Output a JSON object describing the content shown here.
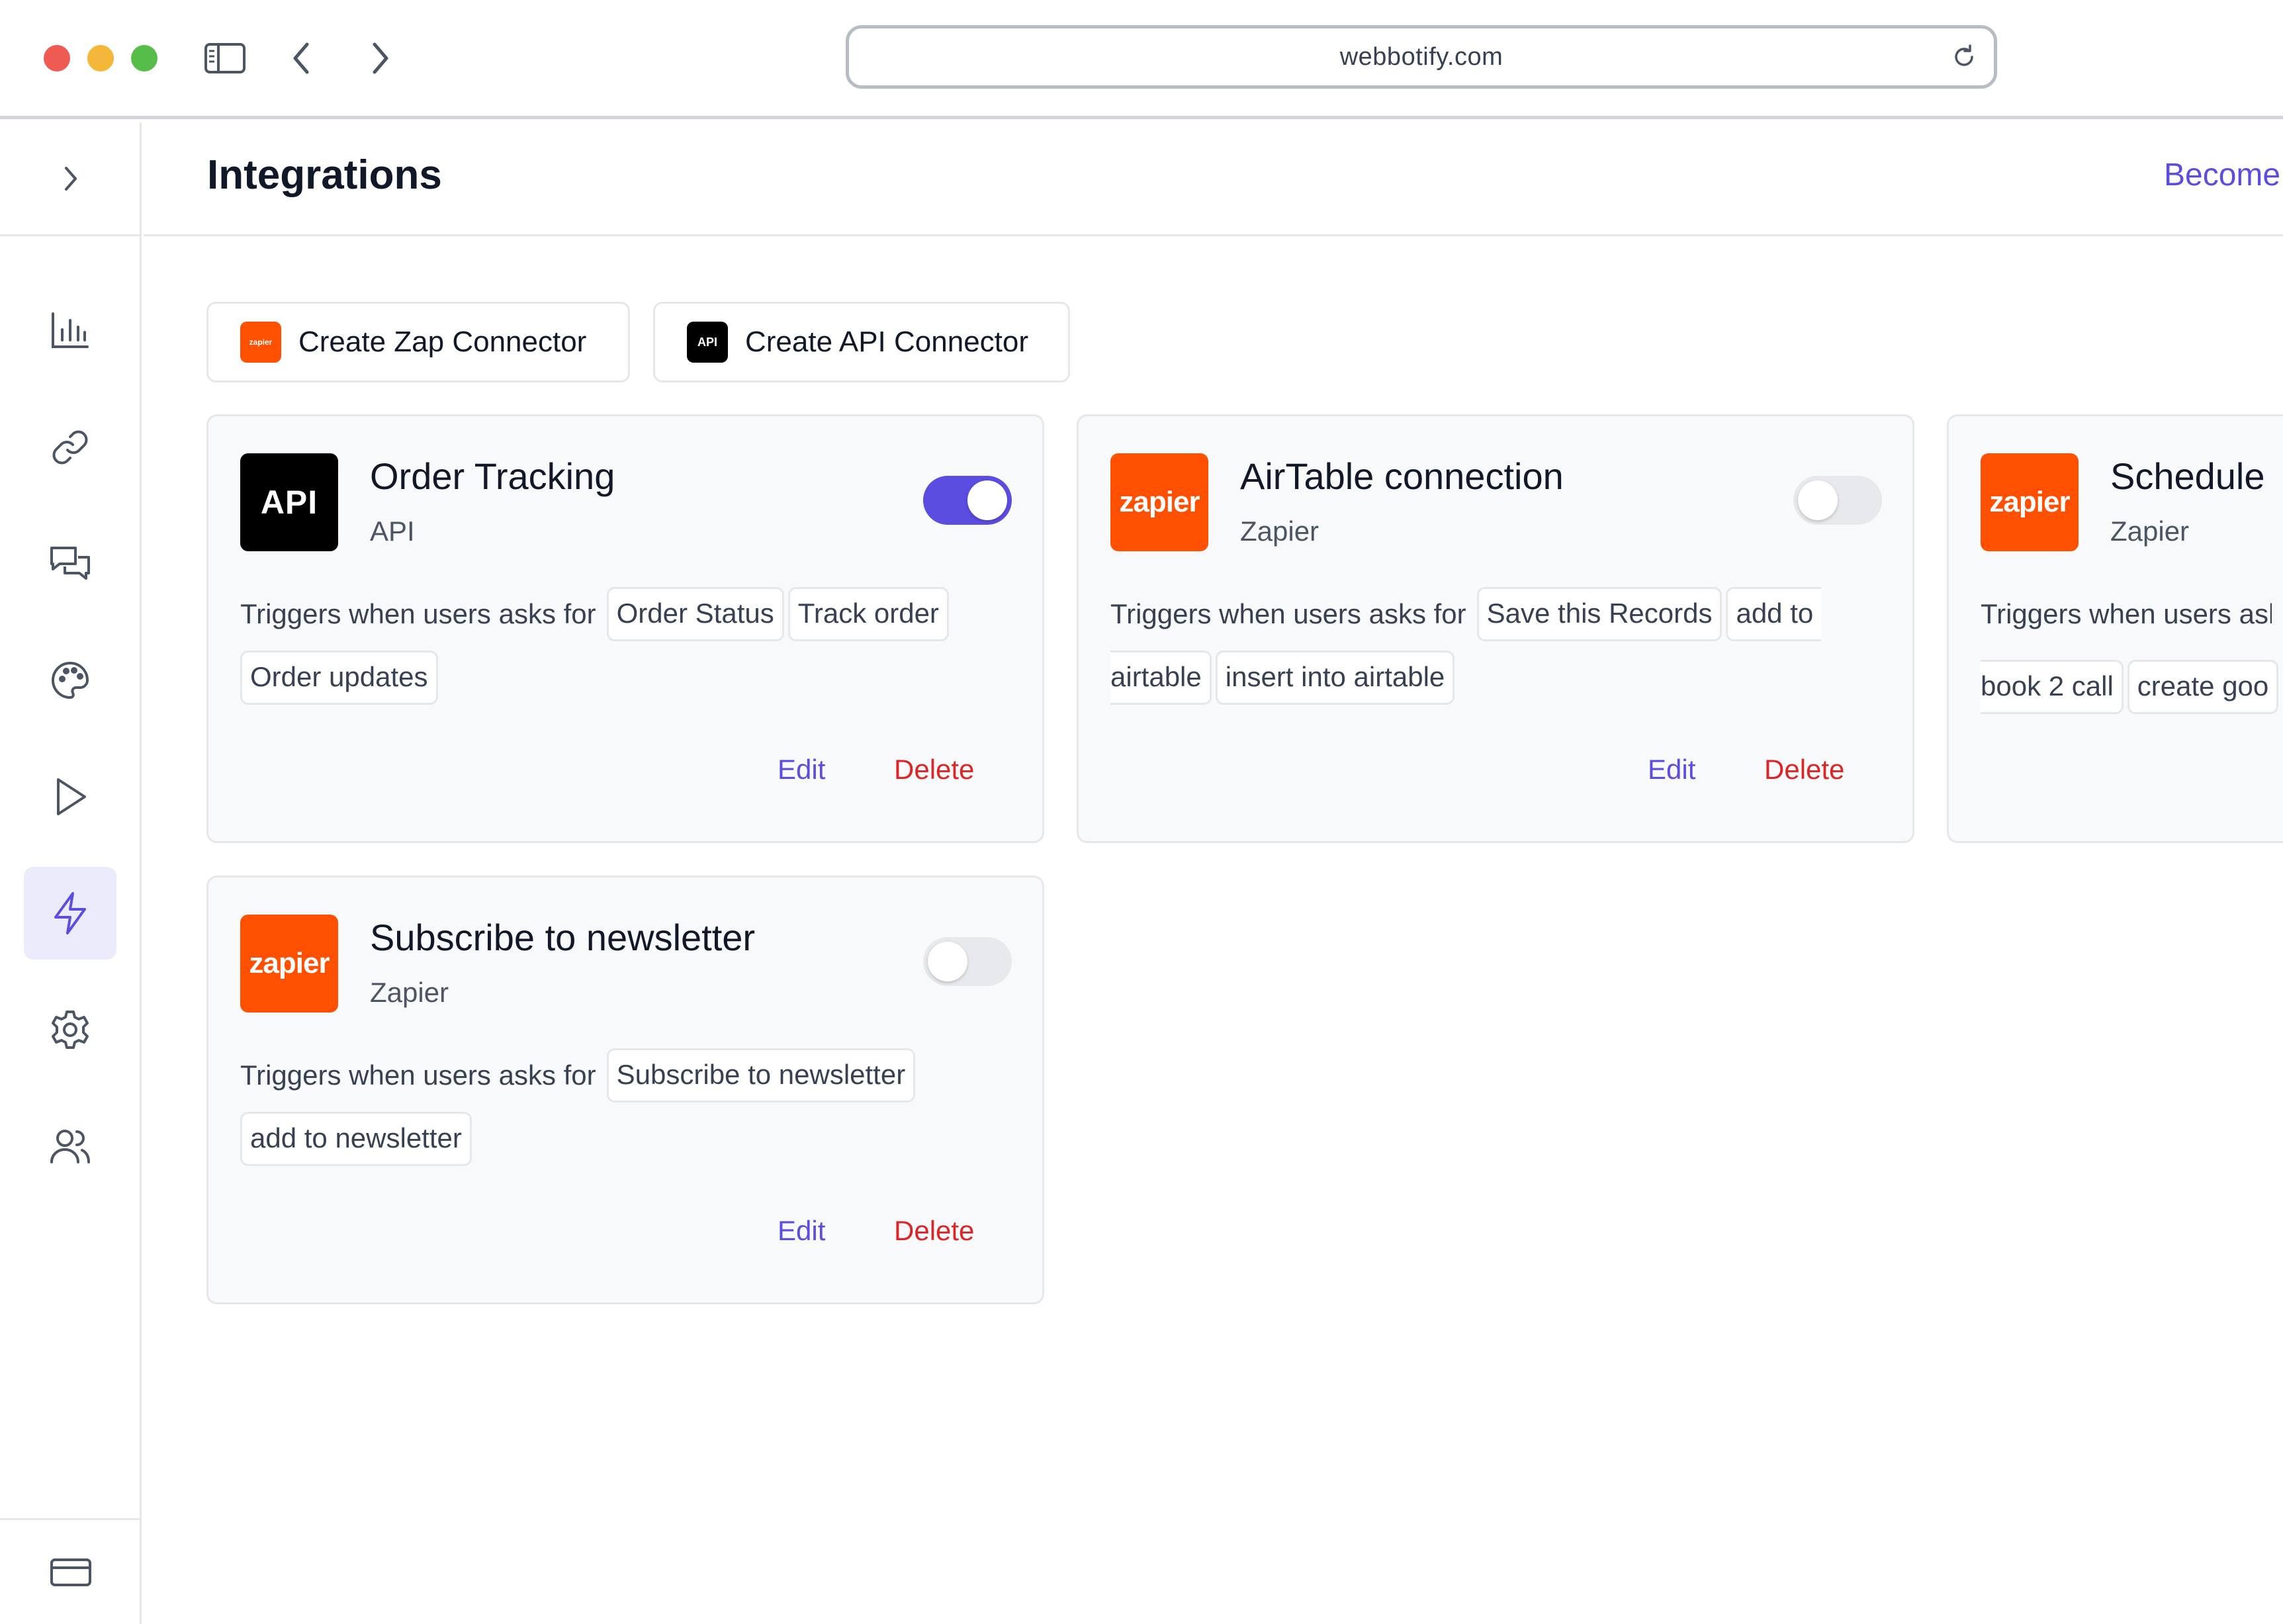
{
  "browser": {
    "url": "webbotify.com"
  },
  "header": {
    "title": "Integrations",
    "right_link": "Become"
  },
  "toolbar": {
    "create_zap_label": "Create Zap Connector",
    "create_zap_logo": "zapier",
    "create_api_label": "Create API Connector",
    "create_api_logo": "API"
  },
  "sidebar": {
    "items": [
      {
        "icon": "bar-chart-icon"
      },
      {
        "icon": "link-icon"
      },
      {
        "icon": "chat-icon"
      },
      {
        "icon": "palette-icon"
      },
      {
        "icon": "play-icon"
      },
      {
        "icon": "bolt-icon",
        "active": true
      },
      {
        "icon": "gear-icon"
      },
      {
        "icon": "users-icon"
      }
    ]
  },
  "trigger_label": "Triggers when users asks for",
  "actions": {
    "edit": "Edit",
    "delete": "Delete"
  },
  "cards": [
    {
      "title": "Order Tracking",
      "type": "API",
      "logo": "API",
      "enabled": true,
      "triggers": [
        "Order Status",
        "Track order",
        "Order updates"
      ]
    },
    {
      "title": "AirTable connection",
      "type": "Zapier",
      "logo": "zapier",
      "enabled": false,
      "triggers": [
        "Save this Records",
        "add to",
        "airtable",
        "insert into airtable"
      ]
    },
    {
      "title": "Schedule",
      "type": "Zapier",
      "logo": "zapier",
      "enabled": false,
      "trigger_label": "Triggers when users ask",
      "triggers": [
        "book 2 call",
        "create goo"
      ]
    },
    {
      "title": "Subscribe to newsletter",
      "type": "Zapier",
      "logo": "zapier",
      "enabled": false,
      "triggers": [
        "Subscribe to newsletter",
        "add to newsletter"
      ]
    }
  ],
  "colors": {
    "accent": "#5b4de0",
    "danger": "#dc2626",
    "zapier": "#ff4f00"
  }
}
